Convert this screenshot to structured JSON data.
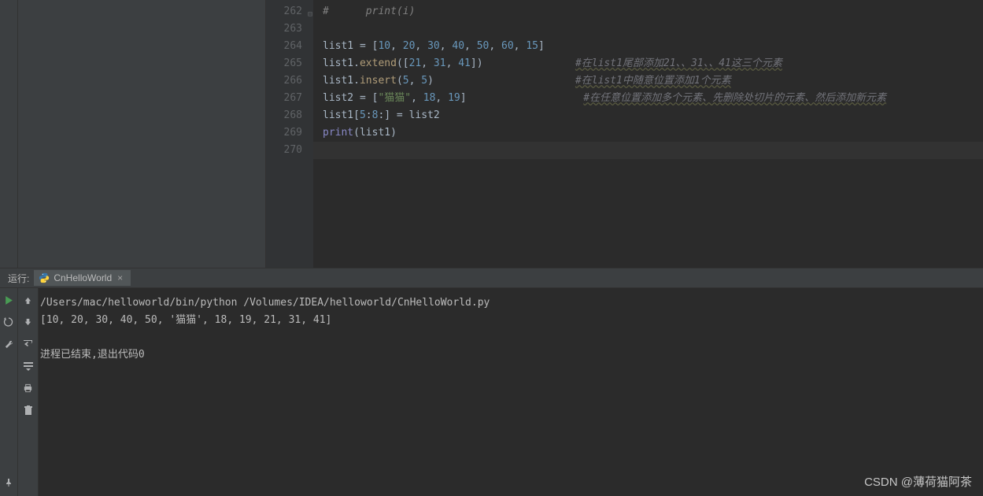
{
  "editor": {
    "lines": [
      "262",
      "263",
      "264",
      "265",
      "266",
      "267",
      "268",
      "269",
      "270"
    ],
    "code262_indent": "#      ",
    "code262_fn": "print",
    "code262_rest": "(i)",
    "l264": {
      "var": "list1",
      "eq": " = [",
      "nums": [
        "10",
        "20",
        "30",
        "40",
        "50",
        "60",
        "15"
      ],
      "close": "]"
    },
    "l265": {
      "pre": "list1.",
      "fn": "extend",
      "open": "([",
      "nums": [
        "21",
        "31",
        "41"
      ],
      "close": "])",
      "comment": "#在list1尾部添加21、、31、、41这三个元素"
    },
    "l266": {
      "pre": "list1.",
      "fn": "insert",
      "open": "(",
      "a": "5",
      "b": "5",
      "close": ")",
      "comment": "#在list1中随意位置添加1个元素"
    },
    "l267": {
      "var": "list2",
      "eq": " = [",
      "str": "\"猫猫\"",
      "n1": "18",
      "n2": "19",
      "close": "]",
      "comment": "#在任意位置添加多个元素、先删除处切片的元素、然后添加新元素"
    },
    "l268": {
      "pre": "list1[",
      "a": "5",
      "b": "8",
      "mid": ":] = list2"
    },
    "l269": {
      "fn": "print",
      "rest": "(list1)"
    }
  },
  "run": {
    "label": "运行:",
    "tab": "CnHelloWorld",
    "out1": "/Users/mac/helloworld/bin/python /Volumes/IDEA/helloworld/CnHelloWorld.py",
    "out2": "[10, 20, 30, 40, 50, '猫猫', 18, 19, 21, 31, 41]",
    "out3": "进程已结束,退出代码0"
  },
  "watermark": "CSDN @薄荷猫阿茶"
}
